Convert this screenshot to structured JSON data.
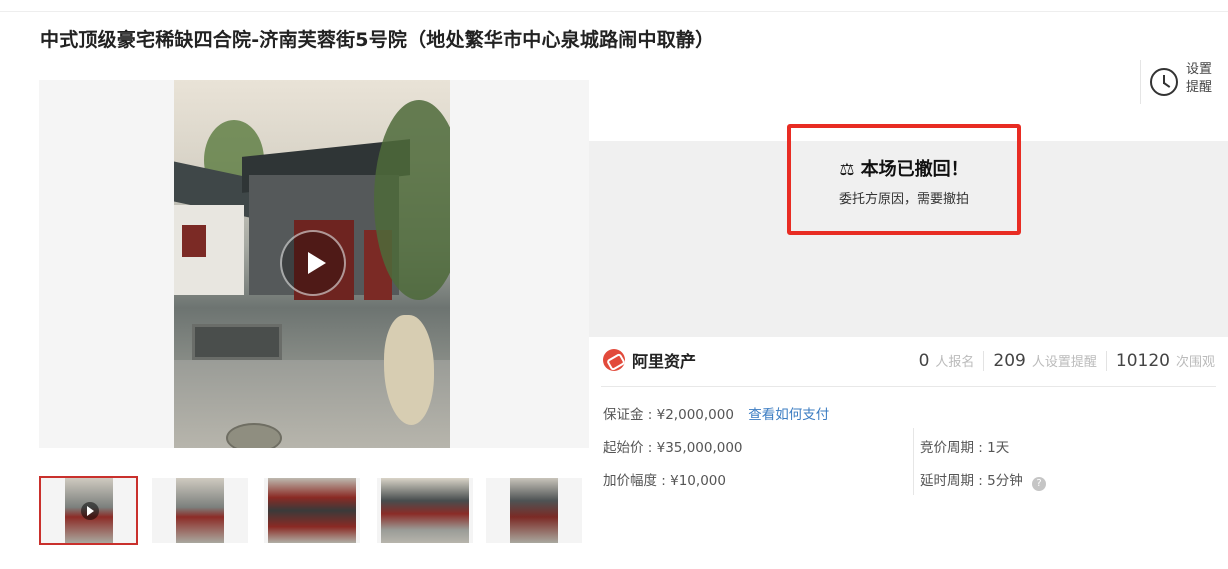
{
  "page": {
    "title": "中式顶级豪宅稀缺四合院-济南芙蓉街5号院（地处繁华市中心泉城路闹中取静）"
  },
  "reminder": {
    "label": "设置提醒",
    "icon": "alarm-clock-icon"
  },
  "status": {
    "title": "本场已撤回！",
    "subtitle": "委托方原因，需要撤拍",
    "icon": "gavel-icon",
    "highlight_color": "#e82c23"
  },
  "brand": {
    "name": "阿里资产",
    "color": "#e24a3b"
  },
  "stats": [
    {
      "value": "0",
      "label": "人报名"
    },
    {
      "value": "209",
      "label": "人设置提醒"
    },
    {
      "value": "10120",
      "label": "次围观"
    }
  ],
  "auction": {
    "deposit": "保证金 : ¥2,000,000",
    "deposit_link": "查看如何支付",
    "start_price": "起始价 : ¥35,000,000",
    "increment": "加价幅度 : ¥10,000",
    "cycle": "竞价周期 : 1天",
    "extension": "延时周期 : 5分钟"
  },
  "gallery": {
    "thumbnail_count": 5,
    "active_index": 0
  }
}
